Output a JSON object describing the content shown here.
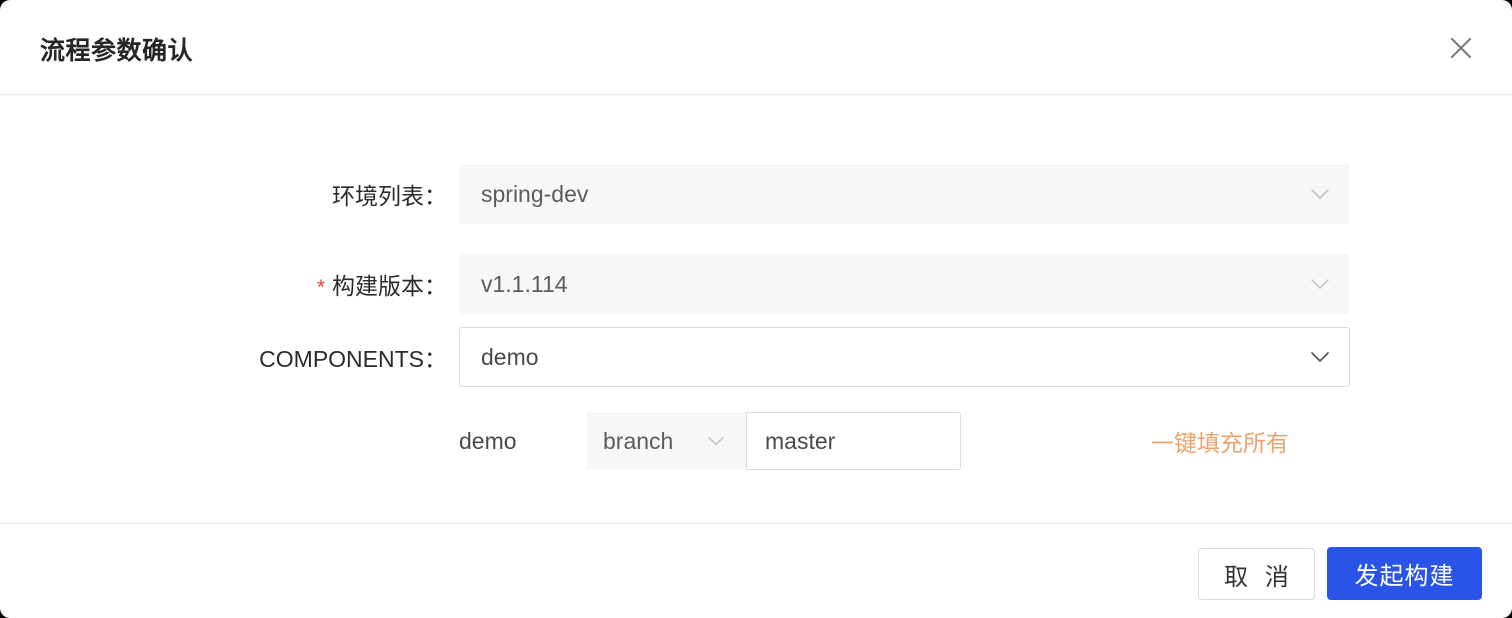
{
  "dialog": {
    "title": "流程参数确认",
    "close_icon": "close-icon"
  },
  "form": {
    "rows": [
      {
        "label": "环境列表：",
        "required": false,
        "value": "spring-dev",
        "state": "disabled",
        "control": "select",
        "icon": "chevron-down-icon"
      },
      {
        "label": "构建版本：",
        "required": true,
        "required_marker": "*",
        "value": "v1.1.114",
        "state": "disabled",
        "control": "select",
        "icon": "chevron-down-icon"
      },
      {
        "label": "COMPONENTS：",
        "required": false,
        "value": "demo",
        "state": "active",
        "control": "select",
        "icon": "chevron-down-icon"
      }
    ],
    "component_row": {
      "name": "demo",
      "ref_type": "branch",
      "ref_type_icon": "chevron-down-icon",
      "ref_value": "master",
      "fill_all_label": "一键填充所有"
    }
  },
  "footer": {
    "cancel_label": "取 消",
    "submit_label": "发起构建"
  },
  "colors": {
    "primary": "#2a54e8",
    "link_orange": "#eda36b",
    "required_red": "#e8403a",
    "field_disabled_bg": "#f7f7f7",
    "border": "#dcdcdc",
    "divider": "#ececec"
  }
}
